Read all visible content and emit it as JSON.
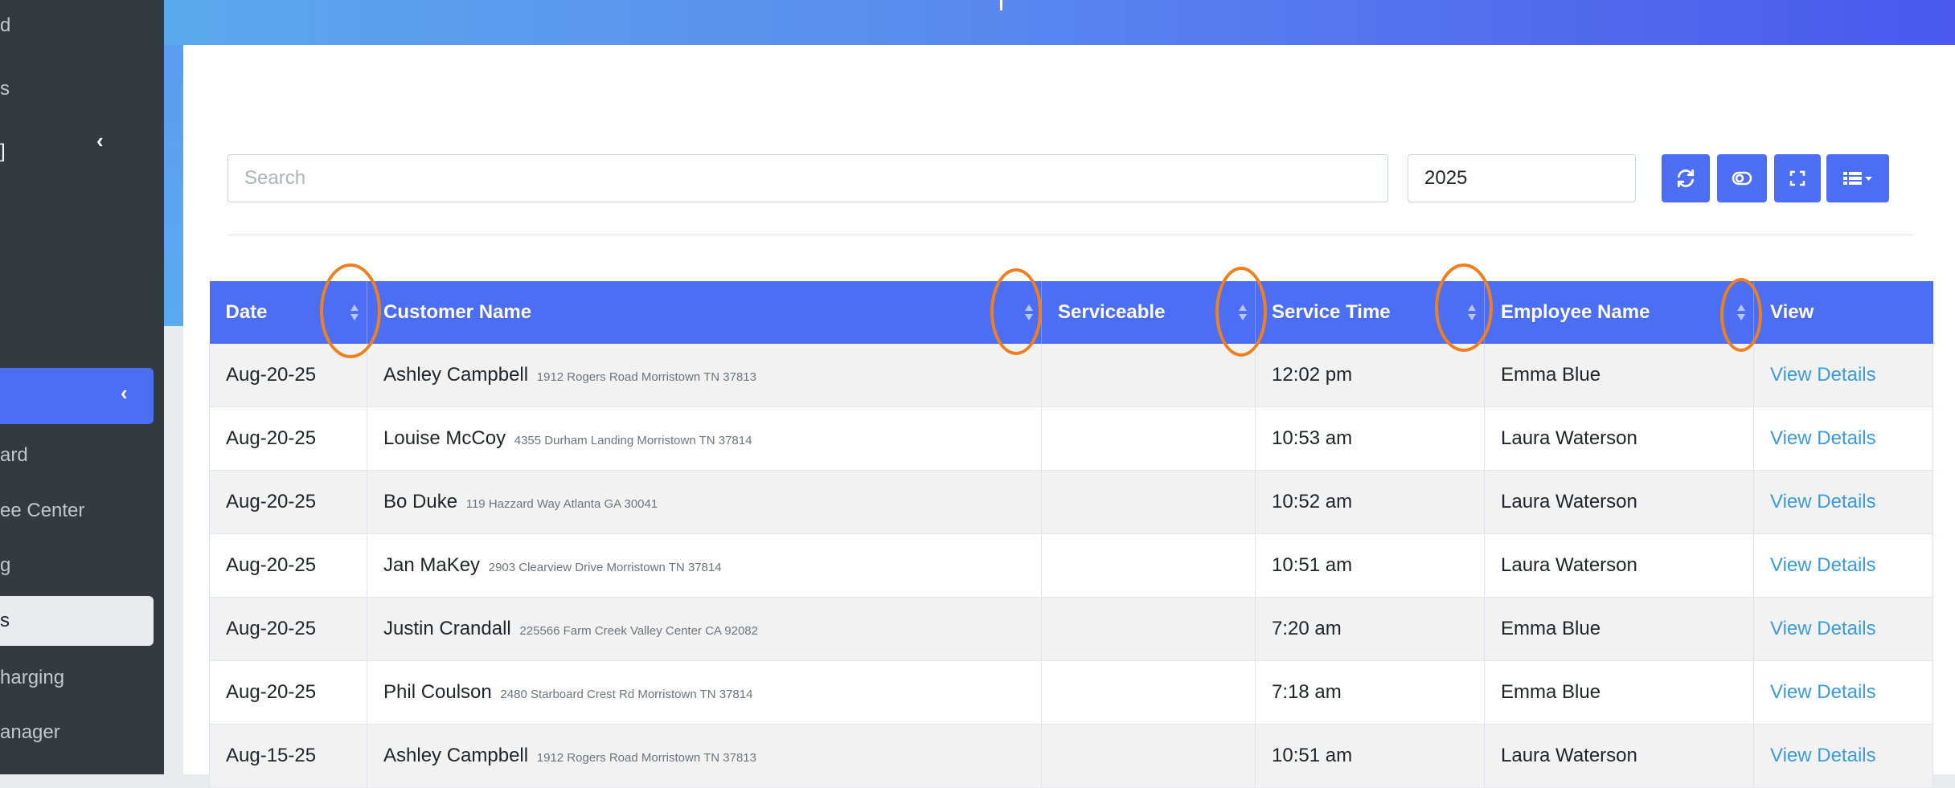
{
  "sidebar": {
    "items": [
      {
        "label": "d"
      },
      {
        "label": "s"
      },
      {
        "label": "]"
      },
      {
        "label": "ard"
      },
      {
        "label": "ee Center"
      },
      {
        "label": "g"
      },
      {
        "label": "s"
      },
      {
        "label": "harging"
      },
      {
        "label": "anager"
      }
    ],
    "chevron": "‹"
  },
  "toolbar": {
    "search_placeholder": "Search",
    "search_value": "",
    "year_value": "2025",
    "buttons": [
      "refresh-icon",
      "toggle-icon",
      "fullscreen-icon",
      "columns-icon"
    ]
  },
  "table": {
    "headers": [
      "Date",
      "Customer Name",
      "Serviceable",
      "Service Time",
      "Employee Name",
      "View"
    ],
    "rows": [
      {
        "date": "Aug-20-25",
        "name": "Ashley Campbell",
        "address": "1912 Rogers Road Morristown TN 37813",
        "serviceable": "",
        "time": "12:02 pm",
        "employee": "Emma Blue",
        "view": "View Details"
      },
      {
        "date": "Aug-20-25",
        "name": "Louise McCoy",
        "address": "4355 Durham Landing Morristown TN 37814",
        "serviceable": "",
        "time": "10:53 am",
        "employee": "Laura Waterson",
        "view": "View Details"
      },
      {
        "date": "Aug-20-25",
        "name": "Bo Duke",
        "address": "119 Hazzard Way Atlanta GA 30041",
        "serviceable": "",
        "time": "10:52 am",
        "employee": "Laura Waterson",
        "view": "View Details"
      },
      {
        "date": "Aug-20-25",
        "name": "Jan MaKey",
        "address": "2903 Clearview Drive Morristown TN 37814",
        "serviceable": "",
        "time": "10:51 am",
        "employee": "Laura Waterson",
        "view": "View Details"
      },
      {
        "date": "Aug-20-25",
        "name": "Justin Crandall",
        "address": "225566 Farm Creek Valley Center CA 92082",
        "serviceable": "",
        "time": "7:20 am",
        "employee": "Emma Blue",
        "view": "View Details"
      },
      {
        "date": "Aug-20-25",
        "name": "Phil Coulson",
        "address": "2480 Starboard Crest Rd Morristown TN 37814",
        "serviceable": "",
        "time": "7:18 am",
        "employee": "Emma Blue",
        "view": "View Details"
      },
      {
        "date": "Aug-15-25",
        "name": "Ashley Campbell",
        "address": "1912 Rogers Road Morristown TN 37813",
        "serviceable": "",
        "time": "10:51 am",
        "employee": "Laura Waterson",
        "view": "View Details"
      }
    ]
  },
  "colors": {
    "accent": "#4c6ef5",
    "highlight_ring": "#f07f1d",
    "link": "#3b9ae1"
  }
}
